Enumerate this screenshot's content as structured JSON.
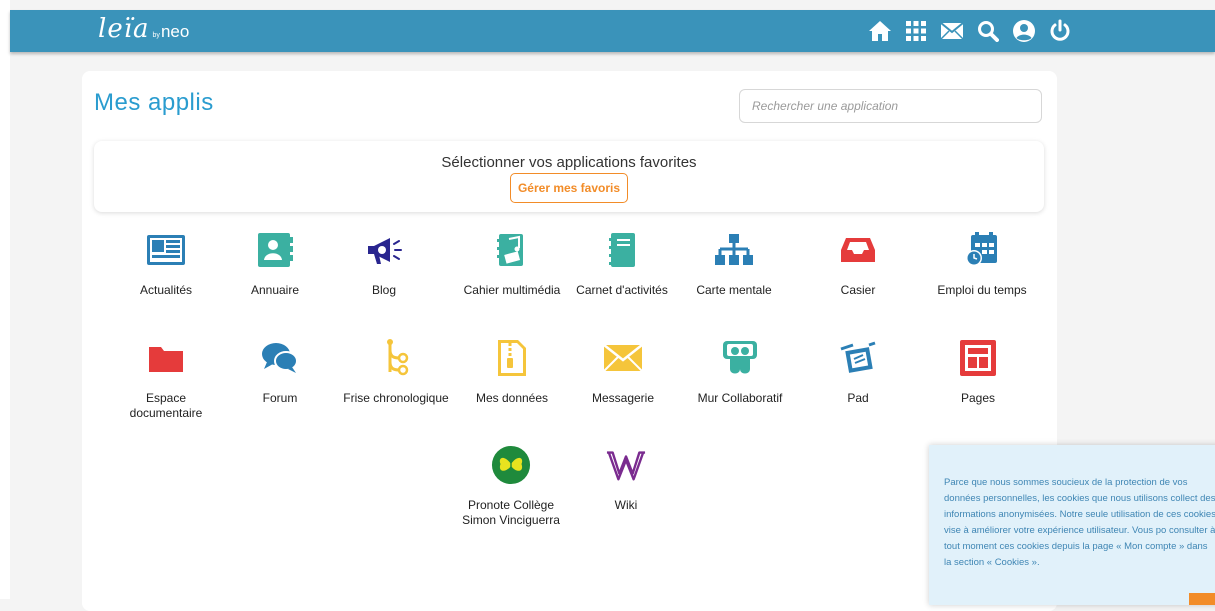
{
  "header": {
    "logo_script": "leïa",
    "logo_by": "by",
    "logo_neo": "neo",
    "nav_icons": [
      "home-icon",
      "apps-grid-icon",
      "mail-icon",
      "search-icon",
      "user-icon",
      "power-icon"
    ],
    "bar_color": "#3a93ba"
  },
  "main": {
    "title": "Mes applis",
    "search_placeholder": "Rechercher une application",
    "favorites": {
      "title": "Sélectionner vos applications favorites",
      "button_label": "Gérer mes favoris"
    },
    "apps": [
      {
        "label": "Actualités",
        "icon": "newspaper-icon",
        "color": "#2b7fb5"
      },
      {
        "label": "Annuaire",
        "icon": "contact-book-icon",
        "color": "#3bb0a1"
      },
      {
        "label": "Blog",
        "icon": "megaphone-icon",
        "color": "#29258f"
      },
      {
        "label": "Cahier multimédia",
        "icon": "multimedia-notebook-icon",
        "color": "#3bb0a1"
      },
      {
        "label": "Carnet d'activités",
        "icon": "notebook-icon",
        "color": "#3bb0a1"
      },
      {
        "label": "Carte mentale",
        "icon": "sitemap-icon",
        "color": "#2b7fb5"
      },
      {
        "label": "Casier",
        "icon": "inbox-tray-icon",
        "color": "#e53b3b"
      },
      {
        "label": "Emploi du temps",
        "icon": "calendar-clock-icon",
        "color": "#2b7fb5"
      },
      {
        "label": "Espace documentaire",
        "icon": "folder-icon",
        "color": "#e53b3b"
      },
      {
        "label": "Forum",
        "icon": "chat-bubbles-icon",
        "color": "#2b7fb5"
      },
      {
        "label": "Frise chronologique",
        "icon": "timeline-icon",
        "color": "#f5c53b"
      },
      {
        "label": "Mes données",
        "icon": "zip-file-icon",
        "color": "#f5c53b"
      },
      {
        "label": "Messagerie",
        "icon": "envelope-icon",
        "color": "#f5c53b"
      },
      {
        "label": "Mur Collaboratif",
        "icon": "collaborative-wall-icon",
        "color": "#3bb0a1"
      },
      {
        "label": "Pad",
        "icon": "pad-icon",
        "color": "#2b7fb5"
      },
      {
        "label": "Pages",
        "icon": "pages-icon",
        "color": "#e53b3b"
      },
      {
        "label": "Pronote Collège Simon Vinciguerra",
        "icon": "pronote-butterfly-icon",
        "color": "#1f8a3c"
      },
      {
        "label": "Wiki",
        "icon": "wikipedia-w-icon",
        "color": "#7a2b8f"
      }
    ]
  },
  "cookie_banner": {
    "text": "Parce que nous sommes soucieux de la protection de vos données personnelles, les cookies que nous utilisons collect des informations anonymisées. Notre seule utilisation de ces cookies vise à améliorer votre expérience utilisateur. Vous po consulter à tout moment ces cookies depuis la page « Mon compte » dans la section « Cookies »."
  }
}
